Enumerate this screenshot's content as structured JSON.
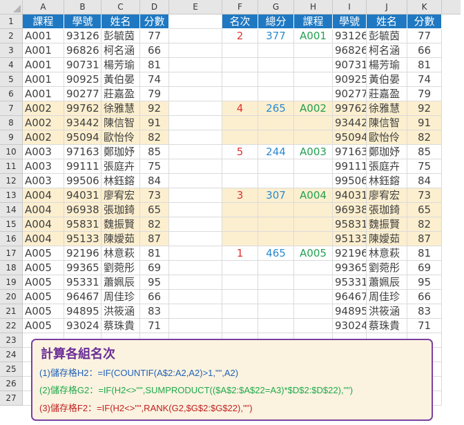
{
  "columns": [
    "A",
    "B",
    "C",
    "D",
    "E",
    "F",
    "G",
    "H",
    "I",
    "J",
    "K"
  ],
  "rows": [
    "1",
    "2",
    "3",
    "4",
    "5",
    "6",
    "7",
    "8",
    "9",
    "10",
    "11",
    "12",
    "13",
    "14",
    "15",
    "16",
    "17",
    "18",
    "19",
    "20",
    "21",
    "22",
    "23",
    "24",
    "25",
    "26",
    "27"
  ],
  "left_table": {
    "headers": [
      "課程",
      "學號",
      "姓名",
      "分數"
    ],
    "rows": [
      [
        "A001",
        "93126",
        "彭毓茵",
        "77"
      ],
      [
        "A001",
        "96826",
        "柯名涵",
        "66"
      ],
      [
        "A001",
        "90731",
        "楊芳瑜",
        "81"
      ],
      [
        "A001",
        "90925",
        "黃伯晏",
        "74"
      ],
      [
        "A001",
        "90277",
        "莊嘉盈",
        "79"
      ],
      [
        "A002",
        "99762",
        "徐雅慧",
        "92"
      ],
      [
        "A002",
        "93442",
        "陳信智",
        "91"
      ],
      [
        "A002",
        "95094",
        "歐怡伶",
        "82"
      ],
      [
        "A003",
        "97163",
        "鄭珈妤",
        "85"
      ],
      [
        "A003",
        "99111",
        "張庭卉",
        "75"
      ],
      [
        "A003",
        "99506",
        "林鈺鎔",
        "84"
      ],
      [
        "A004",
        "94031",
        "廖宥宏",
        "73"
      ],
      [
        "A004",
        "96938",
        "張珈錡",
        "65"
      ],
      [
        "A004",
        "95831",
        "魏振賢",
        "82"
      ],
      [
        "A004",
        "95133",
        "陳嬡茹",
        "87"
      ],
      [
        "A005",
        "92196",
        "林意萩",
        "81"
      ],
      [
        "A005",
        "99365",
        "劉菀彤",
        "69"
      ],
      [
        "A005",
        "95331",
        "蕭姵辰",
        "95"
      ],
      [
        "A005",
        "96467",
        "周佳珍",
        "66"
      ],
      [
        "A005",
        "94895",
        "洪筱涵",
        "83"
      ],
      [
        "A005",
        "93024",
        "蔡珠貴",
        "71"
      ]
    ]
  },
  "right_table": {
    "headers": [
      "名次",
      "總分",
      "課程",
      "學號",
      "姓名",
      "分數"
    ],
    "rows": [
      [
        "2",
        "377",
        "A001",
        "93126",
        "彭毓茵",
        "77"
      ],
      [
        "",
        "",
        "",
        "96826",
        "柯名涵",
        "66"
      ],
      [
        "",
        "",
        "",
        "90731",
        "楊芳瑜",
        "81"
      ],
      [
        "",
        "",
        "",
        "90925",
        "黃伯晏",
        "74"
      ],
      [
        "",
        "",
        "",
        "90277",
        "莊嘉盈",
        "79"
      ],
      [
        "4",
        "265",
        "A002",
        "99762",
        "徐雅慧",
        "92"
      ],
      [
        "",
        "",
        "",
        "93442",
        "陳信智",
        "91"
      ],
      [
        "",
        "",
        "",
        "95094",
        "歐怡伶",
        "82"
      ],
      [
        "5",
        "244",
        "A003",
        "97163",
        "鄭珈妤",
        "85"
      ],
      [
        "",
        "",
        "",
        "99111",
        "張庭卉",
        "75"
      ],
      [
        "",
        "",
        "",
        "99506",
        "林鈺鎔",
        "84"
      ],
      [
        "3",
        "307",
        "A004",
        "94031",
        "廖宥宏",
        "73"
      ],
      [
        "",
        "",
        "",
        "96938",
        "張珈錡",
        "65"
      ],
      [
        "",
        "",
        "",
        "95831",
        "魏振賢",
        "82"
      ],
      [
        "",
        "",
        "",
        "95133",
        "陳嬡茹",
        "87"
      ],
      [
        "1",
        "465",
        "A005",
        "92196",
        "林意萩",
        "81"
      ],
      [
        "",
        "",
        "",
        "99365",
        "劉菀彤",
        "69"
      ],
      [
        "",
        "",
        "",
        "95331",
        "蕭姵辰",
        "95"
      ],
      [
        "",
        "",
        "",
        "96467",
        "周佳珍",
        "66"
      ],
      [
        "",
        "",
        "",
        "94895",
        "洪筱涵",
        "83"
      ],
      [
        "",
        "",
        "",
        "93024",
        "蔡珠貴",
        "71"
      ]
    ]
  },
  "peach_groups": [
    "A002",
    "A004"
  ],
  "note": {
    "title": "計算各組名次",
    "lines": [
      "(1)儲存格H2：=IF(COUNTIF(A$2:A2,A2)>1,\"\",A2)",
      "(2)儲存格G2：=IF(H2<>\"\",SUMPRODUCT(($A$2:$A$22=A3)*$D$2:$D$22),\"\")",
      "(3)儲存格F2：=IF(H2<>\"\",RANK(G2,$G$2:$G$22),\"\")"
    ]
  },
  "colors": {
    "header_blue": "#1f78c1",
    "peach": "#fcefcf",
    "rank_red": "#e03030",
    "total_blue": "#2b8ad0",
    "course_green": "#22a050",
    "note_border": "#7a3fa0"
  }
}
